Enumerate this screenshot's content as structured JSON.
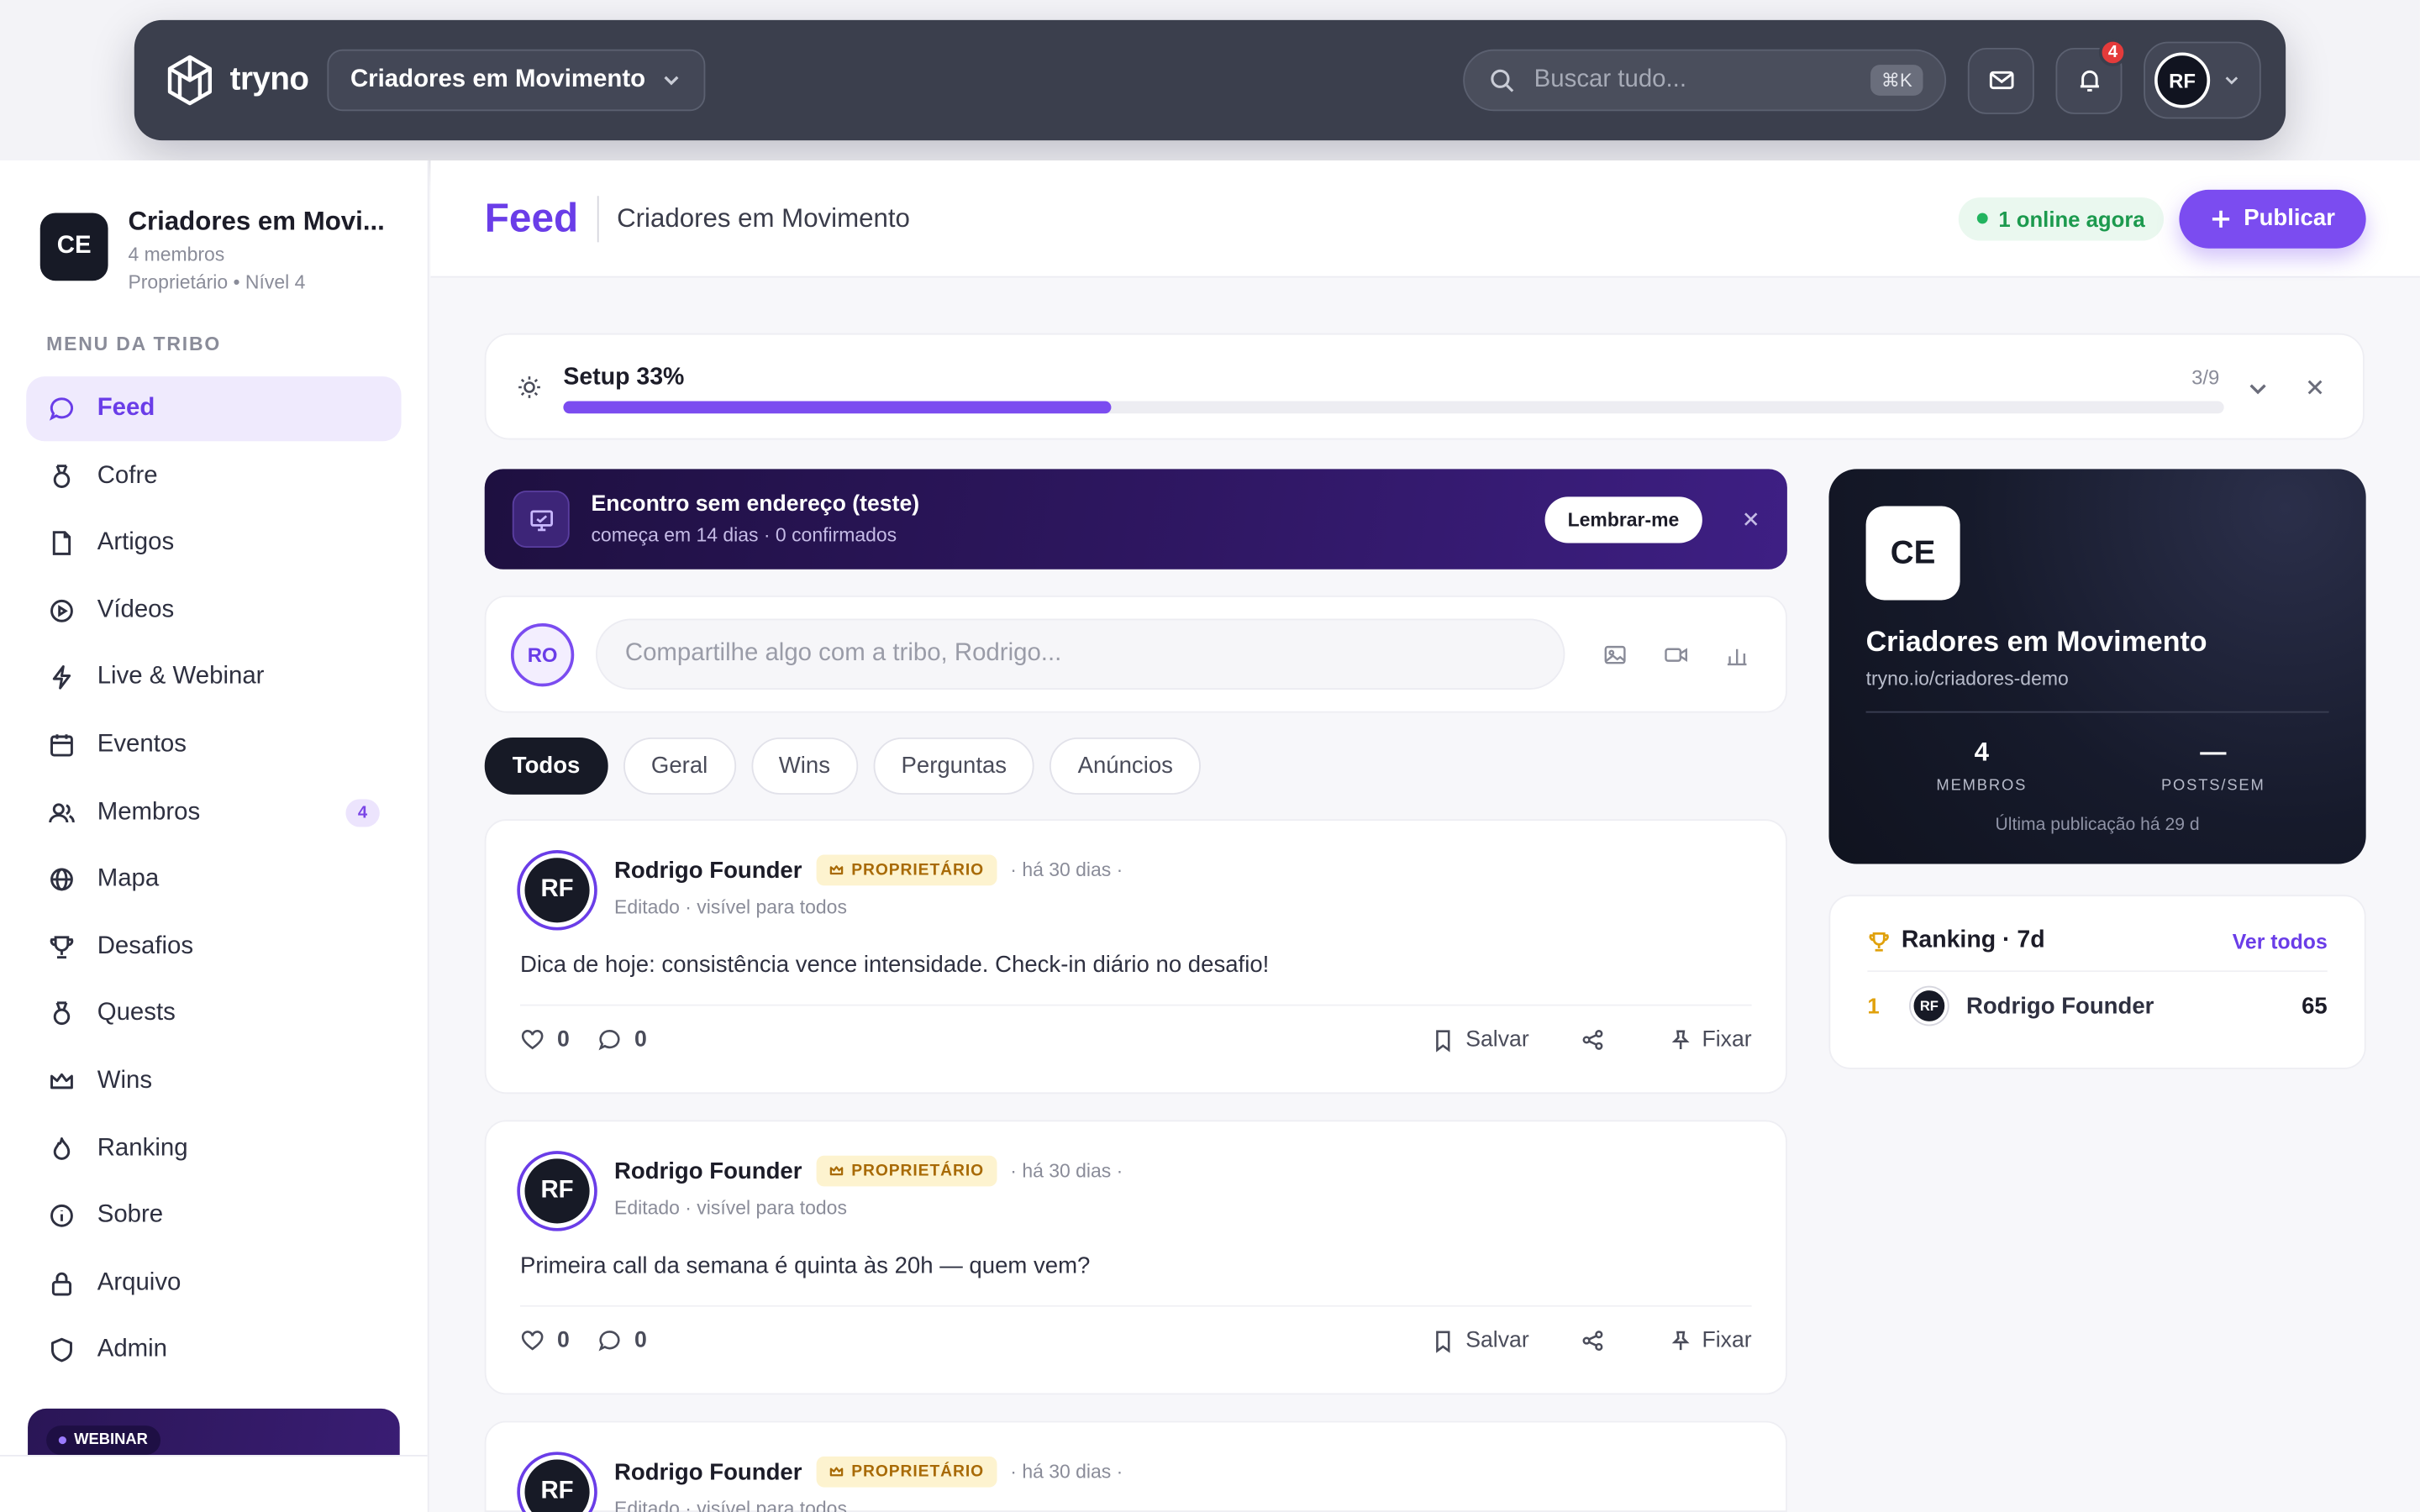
{
  "topbar": {
    "logo_text": "tryno",
    "tribe_switch": "Criadores em Movimento",
    "search_placeholder": "Buscar tudo...",
    "search_shortcut": "⌘K",
    "notifications_count": "4",
    "user_initials": "RF"
  },
  "sidebar": {
    "tribe_initials": "CE",
    "tribe_name": "Criadores em Movi...",
    "tribe_members": "4 membros",
    "tribe_role": "Proprietário • Nível 4",
    "menu_label": "MENU DA TRIBO",
    "items": [
      {
        "label": "Feed",
        "icon": "chat-bubble-icon"
      },
      {
        "label": "Cofre",
        "icon": "medal-icon"
      },
      {
        "label": "Artigos",
        "icon": "document-icon"
      },
      {
        "label": "Vídeos",
        "icon": "play-circle-icon"
      },
      {
        "label": "Live & Webinar",
        "icon": "bolt-icon"
      },
      {
        "label": "Eventos",
        "icon": "calendar-icon"
      },
      {
        "label": "Membros",
        "icon": "users-icon",
        "badge": "4"
      },
      {
        "label": "Mapa",
        "icon": "globe-icon"
      },
      {
        "label": "Desafios",
        "icon": "trophy-icon"
      },
      {
        "label": "Quests",
        "icon": "medal-icon"
      },
      {
        "label": "Wins",
        "icon": "crown-icon"
      },
      {
        "label": "Ranking",
        "icon": "flame-icon"
      },
      {
        "label": "Sobre",
        "icon": "info-icon"
      },
      {
        "label": "Arquivo",
        "icon": "lock-icon"
      },
      {
        "label": "Admin",
        "icon": "shield-icon"
      }
    ],
    "webinar_badge": "WEBINAR"
  },
  "header": {
    "title": "Feed",
    "subtitle": "Criadores em Movimento",
    "online": "1 online agora",
    "publish": "Publicar"
  },
  "setup": {
    "title": "Setup 33%",
    "progress": 0.33,
    "count": "3/9"
  },
  "event": {
    "title": "Encontro sem endereço (teste)",
    "subtitle": "começa em 14 dias · 0 confirmados",
    "remind": "Lembrar-me"
  },
  "composer": {
    "initials": "RO",
    "placeholder": "Compartilhe algo com a tribo, Rodrigo..."
  },
  "filters": [
    "Todos",
    "Geral",
    "Wins",
    "Perguntas",
    "Anúncios"
  ],
  "posts": [
    {
      "initials": "RF",
      "author": "Rodrigo Founder",
      "badge": "PROPRIETÁRIO",
      "time": "· há 30 dias ·",
      "meta": "Editado · visível para todos",
      "body": "Dica de hoje: consistência vence intensidade. Check-in diário no desafio!",
      "likes": "0",
      "comments": "0",
      "save": "Salvar",
      "pin": "Fixar"
    },
    {
      "initials": "RF",
      "author": "Rodrigo Founder",
      "badge": "PROPRIETÁRIO",
      "time": "· há 30 dias ·",
      "meta": "Editado · visível para todos",
      "body": "Primeira call da semana é quinta às 20h — quem vem?",
      "likes": "0",
      "comments": "0",
      "save": "Salvar",
      "pin": "Fixar"
    },
    {
      "initials": "RF",
      "author": "Rodrigo Founder",
      "badge": "PROPRIETÁRIO",
      "time": "· há 30 dias ·",
      "meta": "Editado · visível para todos"
    }
  ],
  "tribe_card": {
    "initials": "CE",
    "name": "Criadores em Movimento",
    "url": "tryno.io/criadores-demo",
    "members_value": "4",
    "members_label": "MEMBROS",
    "posts_value": "—",
    "posts_label": "POSTS/SEM",
    "last_post": "Última publicação há 29 d"
  },
  "ranking": {
    "title": "Ranking · 7d",
    "link": "Ver todos",
    "rows": [
      {
        "pos": "1",
        "initials": "RF",
        "name": "Rodrigo Founder",
        "points": "65"
      }
    ]
  },
  "colors": {
    "accent": "#7b4cf0",
    "topbar": "#3b3f4d",
    "dark_card": "#161a2b",
    "online_green": "#1c9a4e",
    "owner_badge": "#fdf3cf"
  }
}
